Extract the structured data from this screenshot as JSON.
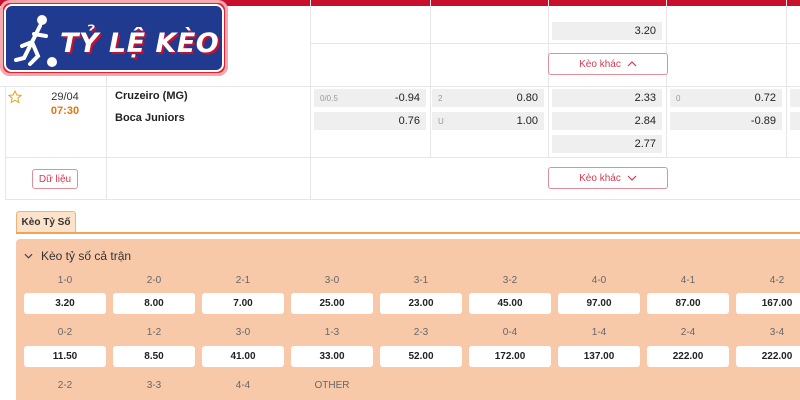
{
  "logo": {
    "text": "TỶ LỆ KÈO"
  },
  "top_odds_row": {
    "value": "3.20",
    "more_label": "Kèo khác"
  },
  "match": {
    "date": "29/04",
    "time": "07:30",
    "home": "Cruzeiro (MG)",
    "away": "Boca Juniors",
    "handicap": {
      "line": "0/0.5",
      "home": "-0.94",
      "away": "0.76"
    },
    "overunder": {
      "line_over": "2",
      "over": "0.80",
      "line_under": "U",
      "under": "1.00"
    },
    "x12": [
      "2.33",
      "2.84",
      "2.77"
    ],
    "half_handicap": {
      "line": "0",
      "home": "0.72",
      "away": "-0.89"
    },
    "more_label": "Kèo khác",
    "data_label": "Dữ liệu"
  },
  "tab": {
    "label": "Kèo Tỷ Số"
  },
  "correct_score": {
    "title": "Kèo tỷ số cả trận",
    "rows": [
      [
        {
          "score": "1-0",
          "odds": "3.20"
        },
        {
          "score": "2-0",
          "odds": "8.00"
        },
        {
          "score": "2-1",
          "odds": "7.00"
        },
        {
          "score": "3-0",
          "odds": "25.00"
        },
        {
          "score": "3-1",
          "odds": "23.00"
        },
        {
          "score": "3-2",
          "odds": "45.00"
        },
        {
          "score": "4-0",
          "odds": "97.00"
        },
        {
          "score": "4-1",
          "odds": "87.00"
        },
        {
          "score": "4-2",
          "odds": "167.00"
        }
      ],
      [
        {
          "score": "0-2",
          "odds": "11.50"
        },
        {
          "score": "1-2",
          "odds": "8.50"
        },
        {
          "score": "3-0",
          "odds": "41.00"
        },
        {
          "score": "1-3",
          "odds": "33.00"
        },
        {
          "score": "2-3",
          "odds": "52.00"
        },
        {
          "score": "0-4",
          "odds": "172.00"
        },
        {
          "score": "1-4",
          "odds": "137.00"
        },
        {
          "score": "2-4",
          "odds": "222.00"
        },
        {
          "score": "3-4",
          "odds": "222.00"
        }
      ],
      [
        {
          "score": "2-2",
          "odds": ""
        },
        {
          "score": "3-3",
          "odds": ""
        },
        {
          "score": "4-4",
          "odds": ""
        },
        {
          "score": "OTHER",
          "odds": ""
        }
      ]
    ]
  }
}
